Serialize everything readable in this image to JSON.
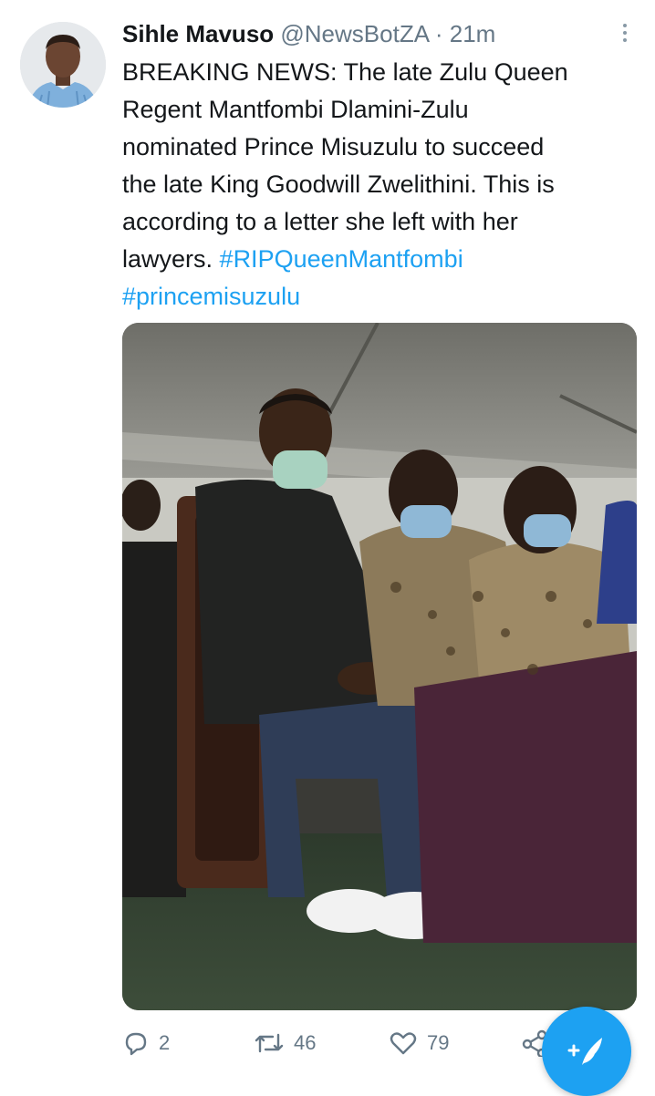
{
  "tweet": {
    "author_name": "Sihle Mavuso",
    "handle": "@NewsBotZA",
    "separator": "·",
    "time": "21m",
    "text_lines": [
      "BREAKING NEWS: The late Zulu Queen",
      "Regent Mantfombi Dlamini-Zulu",
      "nominated Prince Misuzulu to succeed",
      "the late King Goodwill Zwelithini. This is",
      "according to a letter she left with her",
      "lawyers."
    ],
    "hashtags": [
      "#RIPQueenMantfombi",
      "#princemisuzulu"
    ],
    "counts": {
      "replies": "2",
      "retweets": "46",
      "likes": "79"
    }
  },
  "icons": {
    "more": "more-vertical-icon",
    "reply": "reply-icon",
    "retweet": "retweet-icon",
    "like": "heart-icon",
    "share": "share-icon",
    "compose": "compose-tweet-icon"
  },
  "colors": {
    "link": "#1da1f2",
    "muted": "#657786",
    "text": "#14171a",
    "fab": "#1da1f2"
  }
}
